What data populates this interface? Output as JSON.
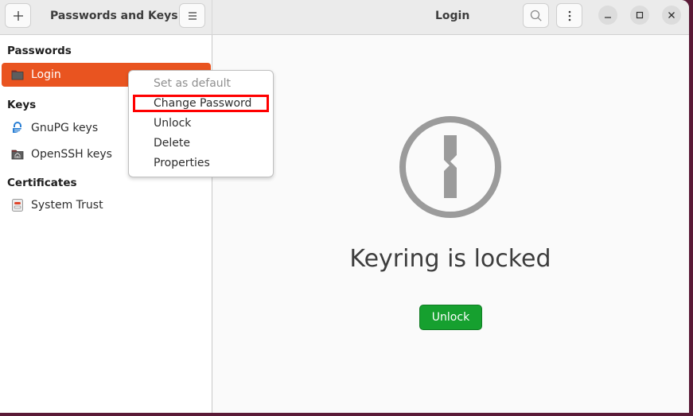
{
  "window": {
    "sidebar_title": "Passwords and Keys",
    "content_title": "Login",
    "add_icon": "plus-icon",
    "menu_icon": "hamburger-icon",
    "search_icon": "search-icon",
    "more_icon": "vertical-dots-icon",
    "minimize_icon": "minimize-icon",
    "maximize_icon": "maximize-icon",
    "close_icon": "close-icon"
  },
  "sidebar": {
    "sections": [
      {
        "label": "Passwords",
        "items": [
          {
            "label": "Login",
            "icon": "folder-icon",
            "selected": true
          }
        ]
      },
      {
        "label": "Keys",
        "items": [
          {
            "label": "GnuPG keys",
            "icon": "gnupg-icon"
          },
          {
            "label": "OpenSSH keys",
            "icon": "ssh-folder-icon"
          }
        ]
      },
      {
        "label": "Certificates",
        "items": [
          {
            "label": "System Trust",
            "icon": "certificate-icon"
          }
        ]
      }
    ]
  },
  "context_menu": {
    "items": [
      {
        "label": "Set as default",
        "enabled": false
      },
      {
        "label": "Change Password",
        "enabled": true,
        "highlighted": true
      },
      {
        "label": "Unlock",
        "enabled": true
      },
      {
        "label": "Delete",
        "enabled": true
      },
      {
        "label": "Properties",
        "enabled": true
      }
    ]
  },
  "main": {
    "status_icon": "keyhole-lock-icon",
    "message": "Keyring is locked",
    "unlock_label": "Unlock"
  },
  "colors": {
    "accent": "#e95420",
    "unlock_button": "#16a02f",
    "highlight_box": "#ff0000",
    "desktop": "#5a1a37"
  }
}
